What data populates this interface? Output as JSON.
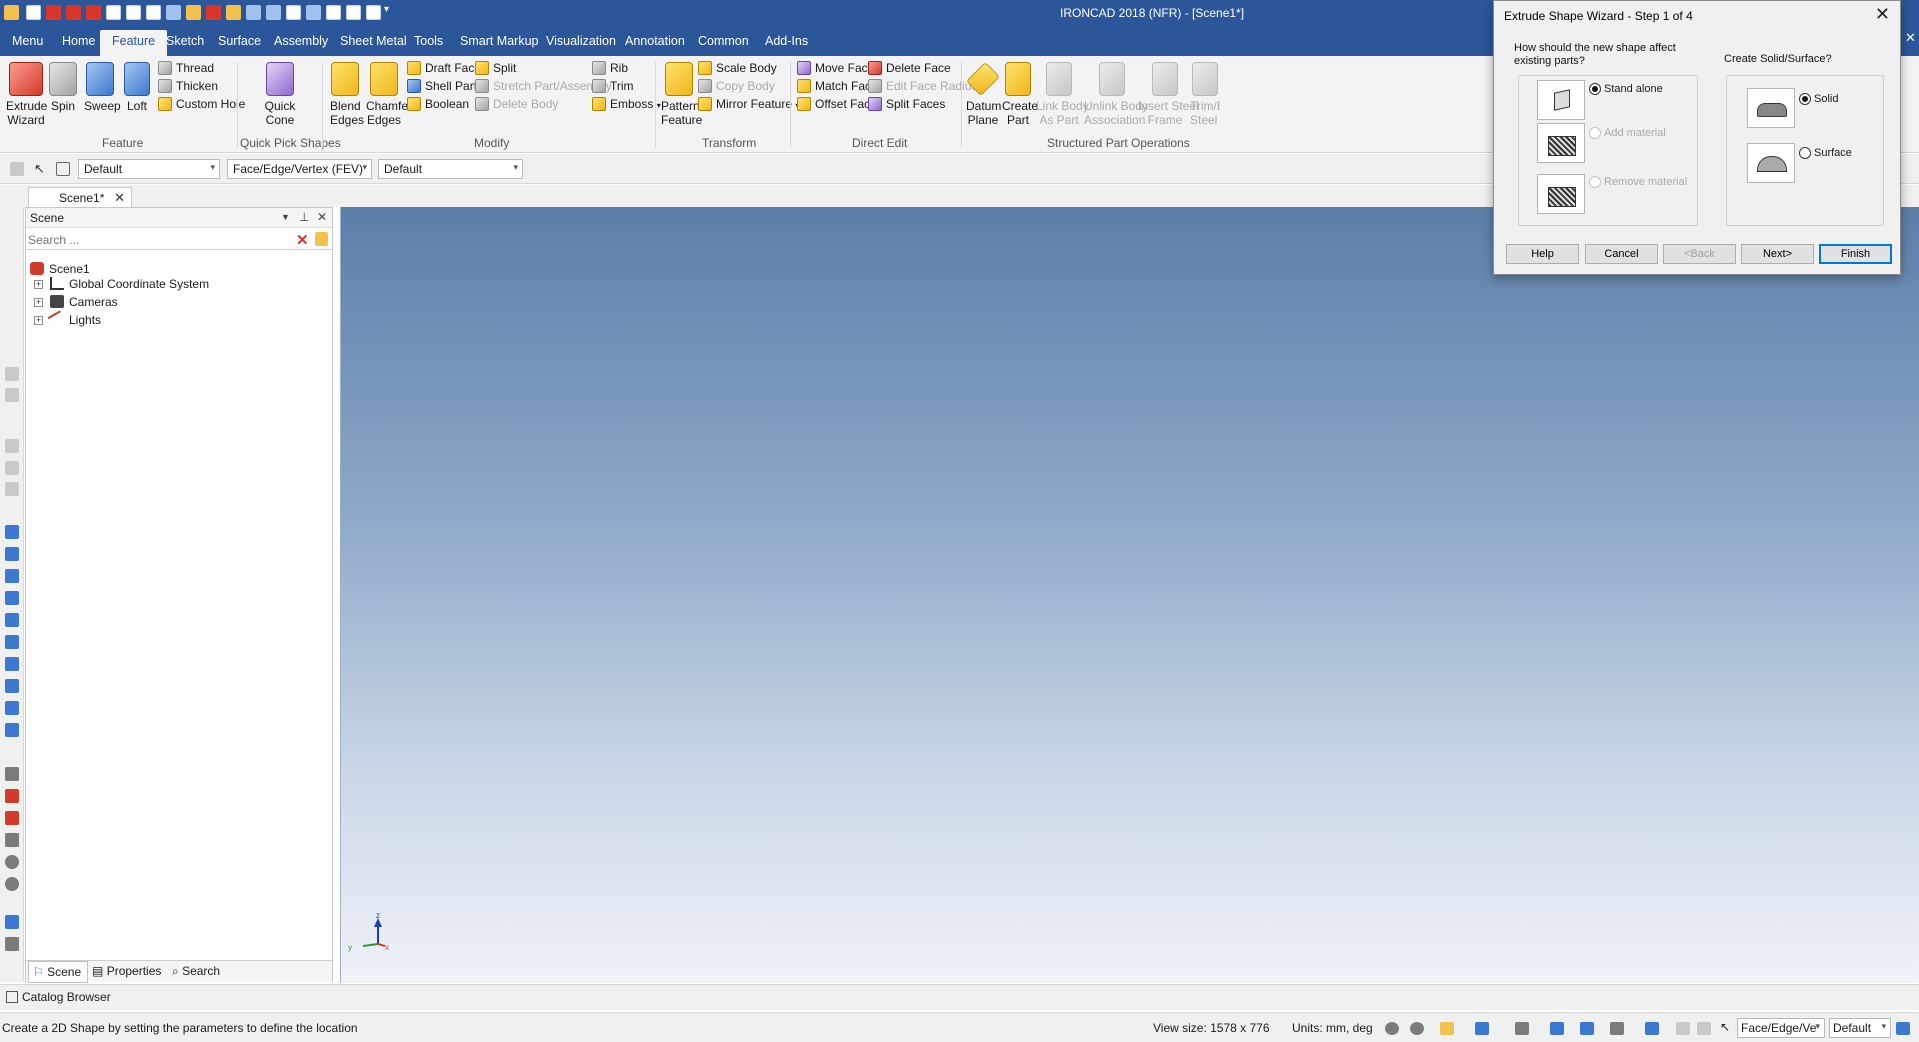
{
  "app_title": "IRONCAD 2018 (NFR) - [Scene1*]",
  "tabs": [
    "Menu",
    "Home",
    "Feature",
    "Sketch",
    "Surface",
    "Assembly",
    "Sheet Metal",
    "Tools",
    "Smart Markup",
    "Visualization",
    "Annotation",
    "Common",
    "Add-Ins"
  ],
  "ribbon": {
    "feature": {
      "extrude": "Extrude\nWizard",
      "spin": "Spin",
      "sweep": "Sweep",
      "loft": "Loft",
      "thread": "Thread",
      "thicken": "Thicken",
      "custom_hole": "Custom Hole",
      "group": "Feature"
    },
    "quick_pick": {
      "quick_cone": "Quick\nCone",
      "group": "Quick Pick Shapes"
    },
    "modify": {
      "blend_edges": "Blend\nEdges",
      "chamfer_edges": "Chamfer\nEdges",
      "draft_faces": "Draft Faces",
      "shell_part": "Shell Part",
      "boolean": "Boolean",
      "split": "Split",
      "stretch": "Stretch Part/Assembly",
      "delete_body": "Delete Body",
      "rib": "Rib",
      "trim": "Trim",
      "emboss": "Emboss",
      "group": "Modify"
    },
    "transform": {
      "pattern_feature": "Pattern\nFeature",
      "scale_body": "Scale Body",
      "copy_body": "Copy Body",
      "mirror_feature": "Mirror Feature",
      "group": "Transform"
    },
    "direct_edit": {
      "move_face": "Move Face",
      "match_face": "Match Face",
      "offset_face": "Offset Face",
      "delete_face": "Delete Face",
      "edit_face_radius": "Edit Face Radius",
      "split_faces": "Split Faces",
      "group": "Direct Edit"
    },
    "structured": {
      "datum_plane": "Datum\nPlane",
      "create_part": "Create\nPart",
      "link_body": "Link Body\nAs Part",
      "unlink_body": "Unlink Body\nAssociation",
      "insert_steel": "Insert Steel\nFrame",
      "trim_steel": "Trim/E\nSteel F",
      "group": "Structured Part Operations"
    }
  },
  "toolbar": {
    "combo1": "Default",
    "combo2": "Face/Edge/Vertex (FEV)",
    "combo3": "Default"
  },
  "doc_tab": "Scene1*",
  "scene_panel": {
    "title": "Scene",
    "search_placeholder": "Search ...",
    "tree": {
      "root": "Scene1",
      "children": [
        "Global Coordinate System",
        "Cameras",
        "Lights"
      ]
    },
    "bottom_tabs": [
      "Scene",
      "Properties",
      "Search"
    ]
  },
  "triad": {
    "z": "z",
    "y": "y",
    "x": "x"
  },
  "catalog_browser": "Catalog Browser",
  "status": {
    "message": "Create a 2D Shape by setting the parameters to define the location",
    "view_size": "View size: 1578 x  776",
    "units": "Units: mm, deg",
    "combo1": "Face/Edge/Ve",
    "combo2": "Default"
  },
  "wizard": {
    "title": "Extrude Shape Wizard - Step 1 of 4",
    "question": "How should the new shape affect\nexisting parts?",
    "options": [
      "Stand alone",
      "Add material",
      "Remove material"
    ],
    "selected": "Stand alone",
    "solid_question": "Create Solid/Surface?",
    "solid_options": [
      "Solid",
      "Surface"
    ],
    "solid_selected": "Solid",
    "buttons": {
      "help": "Help",
      "cancel": "Cancel",
      "back": "<Back",
      "next": "Next>",
      "finish": "Finish"
    }
  },
  "colors": {
    "accent": "#2b579a",
    "viewport_top": "#5b7ea8",
    "viewport_bottom": "#f0f3f8"
  }
}
